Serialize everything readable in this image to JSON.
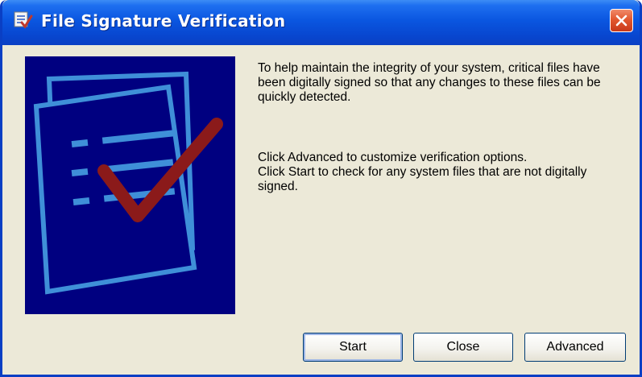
{
  "window": {
    "title": "File Signature Verification",
    "icon": "file-verify-icon"
  },
  "title_controls": {
    "close_icon": "close-icon"
  },
  "illustration": {
    "icon": "document-checkmark-icon"
  },
  "message": {
    "line_1": "To help maintain the integrity of your system, critical files have been digitally signed so that any changes to these files can be quickly detected.",
    "line_2": "Click Advanced to customize verification options.",
    "line_3": "Click Start to check for any system files that are not digitally signed."
  },
  "buttons": {
    "start": "Start",
    "close": "Close",
    "advanced": "Advanced"
  },
  "colors": {
    "titlebar": "#0a56e0",
    "dialog_background": "#ece9d8",
    "illustration_background": "#000080",
    "checkmark": "#8b1a1a",
    "close_button": "#e2582f"
  }
}
